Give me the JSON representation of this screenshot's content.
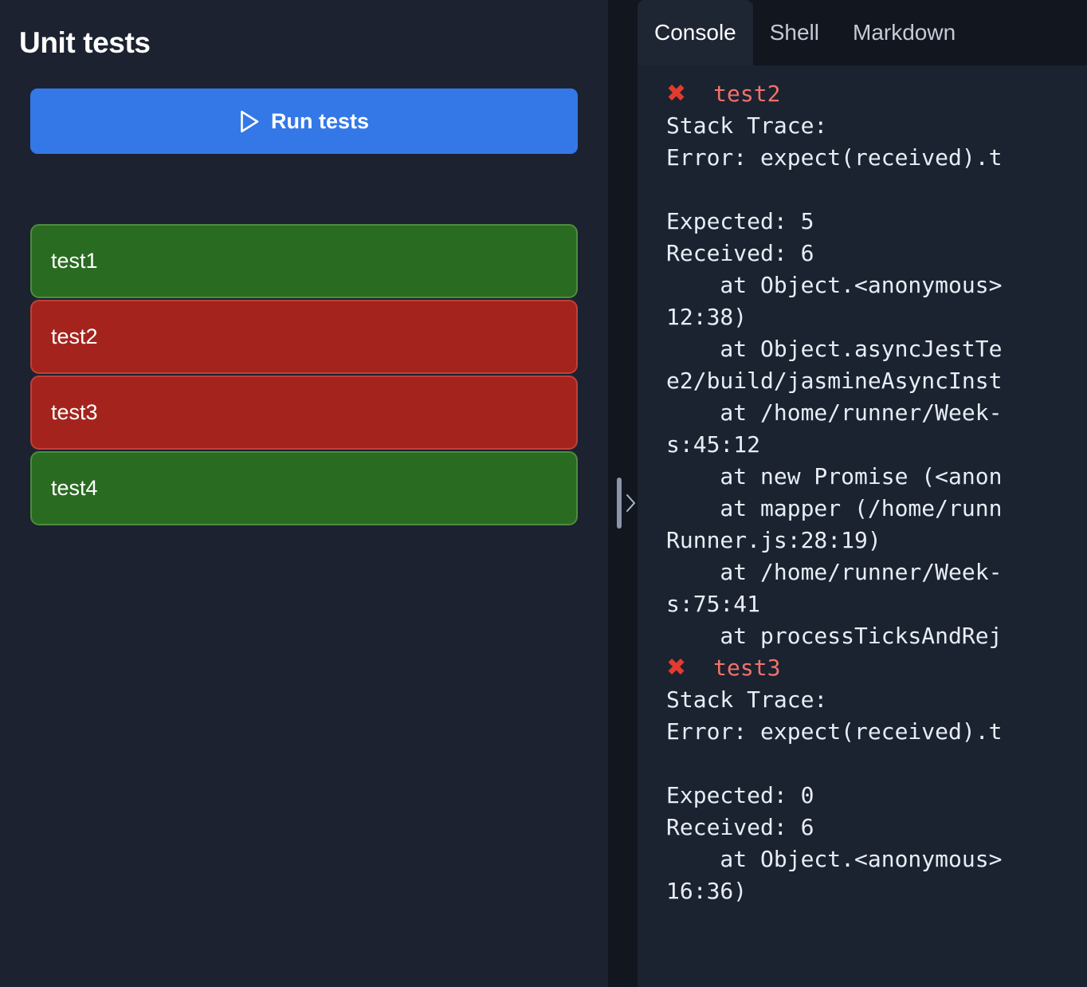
{
  "left": {
    "title": "Unit tests",
    "run_button": {
      "label": "Run tests",
      "icon": "play-icon",
      "color": "#3478e8"
    },
    "tests": [
      {
        "name": "test1",
        "status": "pass",
        "color": "#2a6b22"
      },
      {
        "name": "test2",
        "status": "fail",
        "color": "#a4241d"
      },
      {
        "name": "test3",
        "status": "fail",
        "color": "#a4241d"
      },
      {
        "name": "test4",
        "status": "pass",
        "color": "#2a6b22"
      }
    ]
  },
  "divider": {
    "grip_icon": "drag-handle-icon",
    "expand_icon": "chevron-right-icon"
  },
  "right": {
    "tabs": [
      {
        "label": "Console",
        "active": true
      },
      {
        "label": "Shell",
        "active": false
      },
      {
        "label": "Markdown",
        "active": false
      }
    ],
    "console": {
      "blocks": [
        {
          "mark": "✖",
          "test_name": "test2",
          "lines": [
            "Stack Trace:",
            "Error: expect(received).t",
            "",
            "Expected: 5",
            "Received: 6",
            "    at Object.<anonymous>",
            "12:38)",
            "    at Object.asyncJestTe",
            "e2/build/jasmineAsyncInst",
            "    at /home/runner/Week-",
            "s:45:12",
            "    at new Promise (<anon",
            "    at mapper (/home/runn",
            "Runner.js:28:19)",
            "    at /home/runner/Week-",
            "s:75:41",
            "    at processTicksAndRej"
          ]
        },
        {
          "mark": "✖",
          "test_name": "test3",
          "lines": [
            "Stack Trace:",
            "Error: expect(received).t",
            "",
            "Expected: 0",
            "Received: 6",
            "    at Object.<anonymous>",
            "16:36)"
          ]
        }
      ]
    }
  }
}
